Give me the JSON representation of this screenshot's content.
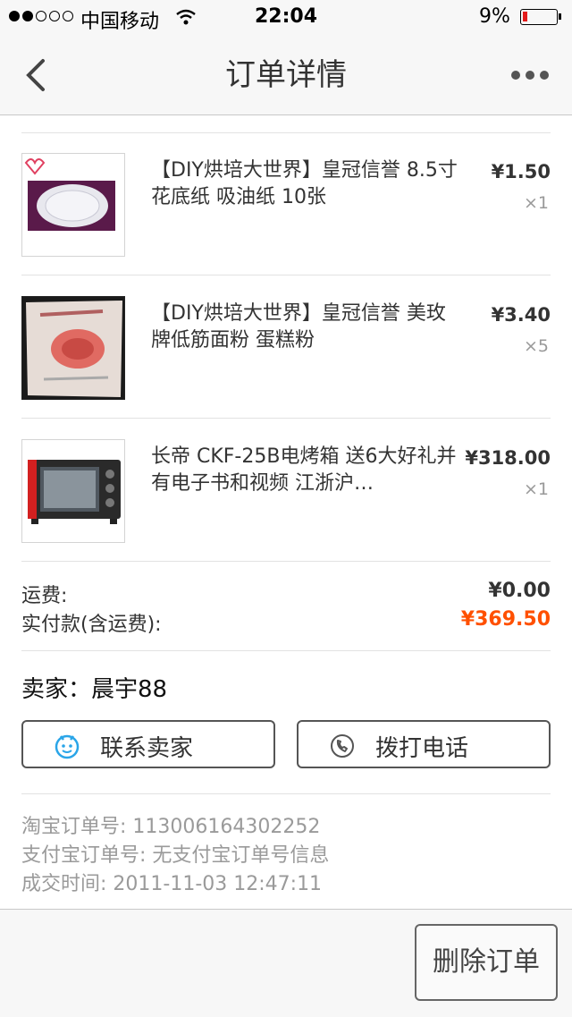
{
  "status_bar": {
    "carrier": "中国移动",
    "time": "22:04",
    "battery": "9%"
  },
  "nav": {
    "title": "订单详情",
    "back_icon": "chevron-left-icon",
    "more_icon": "more-icon"
  },
  "items": [
    {
      "title": "【DIY烘培大世界】皇冠信誉  8.5寸花底纸 吸油纸 10张",
      "price": "¥1.50",
      "qty": "×1"
    },
    {
      "title": "【DIY烘培大世界】皇冠信誉 美玫牌低筋面粉 蛋糕粉",
      "price": "¥3.40",
      "qty": "×5"
    },
    {
      "title": "长帝 CKF-25B电烤箱 送6大好礼并有电子书和视频 江浙沪…",
      "price": "¥318.00",
      "qty": "×1"
    }
  ],
  "summary": {
    "shipping_label": "运费:",
    "shipping_value": "¥0.00",
    "total_label": "实付款(含运费):",
    "total_value": "¥369.50"
  },
  "seller": {
    "text": "卖家：晨宇88"
  },
  "actions": {
    "contact_label": "联系卖家",
    "call_label": "拨打电话"
  },
  "order_info": {
    "taobao_no": "淘宝订单号: 113006164302252",
    "alipay_no": "支付宝订单号: 无支付宝订单号信息",
    "deal_time": "成交时间: 2011-11-03 12:47:11"
  },
  "bottom": {
    "delete_label": "删除订单"
  },
  "colors": {
    "accent_orange": "#ff5000",
    "contact_icon_blue": "#2aa5e8"
  }
}
